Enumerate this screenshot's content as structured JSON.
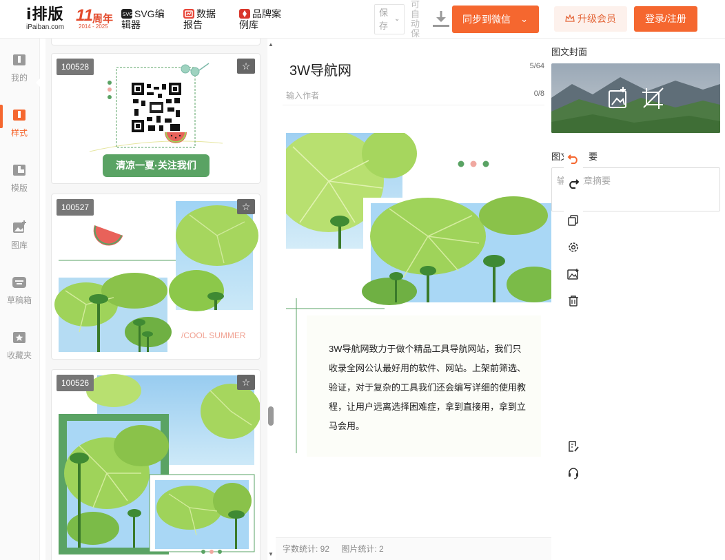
{
  "header": {
    "logo_main": "i排版",
    "logo_sub": "iPaiban.com",
    "anniv_num": "11",
    "anniv_word": "周年",
    "anniv_years": "2014 - 2025",
    "nav": [
      {
        "line1": "SVG编",
        "line2": "辑器",
        "icon": "svg-editor-icon",
        "color": "#222222"
      },
      {
        "line1": "数据",
        "line2": "报告",
        "icon": "data-report-icon",
        "color": "#e8473a"
      },
      {
        "line1": "品牌案",
        "line2": "例库",
        "icon": "brand-case-icon",
        "color": "#d9362b"
      }
    ],
    "save_line1": "保",
    "save_line2": "存",
    "autosave": "可自动保",
    "sync_label": "同步到微信",
    "vip_label": "升级会员",
    "login_label": "登录/注册"
  },
  "rail": [
    {
      "label": "我的",
      "icon": "my-icon",
      "active": false
    },
    {
      "label": "样式",
      "icon": "style-icon",
      "active": true
    },
    {
      "label": "模版",
      "icon": "template-icon",
      "active": false
    },
    {
      "label": "图库",
      "icon": "gallery-icon",
      "active": false
    },
    {
      "label": "草稿箱",
      "icon": "drafts-icon",
      "active": false
    },
    {
      "label": "收藏夹",
      "icon": "favorites-icon",
      "active": false
    }
  ],
  "cards": [
    {
      "id": "100528",
      "button_text": "清凉一夏·关注我们"
    },
    {
      "id": "100527",
      "tagline": "/COOL SUMMER"
    },
    {
      "id": "100526"
    }
  ],
  "editor": {
    "title": "3W导航网",
    "title_count": "5/64",
    "author_placeholder": "输入作者",
    "author_count": "0/8",
    "body": "3W导航网致力于做个精品工具导航网站，我们只收录全网公认最好用的软件、网站。上架前筛选、验证，对于复杂的工具我们还会编写详细的使用教程，让用户远离选择困难症，拿到直接用，拿到立马会用。",
    "word_count": "字数统计: 92",
    "image_count": "图片统计: 2"
  },
  "panel": {
    "cover_label": "图文封面",
    "summary_label_a": "图文摘要",
    "summary_label_b": "要",
    "summary_placeholder": "输入文章摘要"
  },
  "colors": {
    "accent": "#f5672f",
    "green": "#5aa364",
    "leaf": "#9fd35a",
    "sky": "#a9d7f5"
  }
}
